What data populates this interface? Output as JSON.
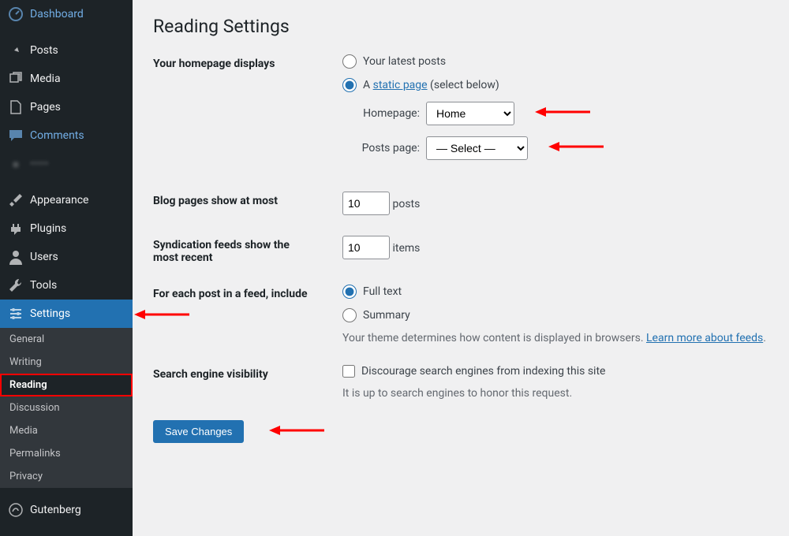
{
  "sidebar": {
    "items": [
      "Dashboard",
      "Posts",
      "Media",
      "Pages",
      "Comments"
    ],
    "items2": [
      "Appearance",
      "Plugins",
      "Users",
      "Tools",
      "Settings"
    ],
    "settings_sub": [
      "General",
      "Writing",
      "Reading",
      "Discussion",
      "Media",
      "Permalinks",
      "Privacy"
    ],
    "items3": [
      "Gutenberg"
    ]
  },
  "icons": {
    "dashboard": "dashboard-icon",
    "posts": "pin-icon",
    "media": "media-icon",
    "pages": "pages-icon",
    "comments": "comments-icon",
    "appearance": "brush-icon",
    "plugins": "plug-icon",
    "users": "user-icon",
    "tools": "wrench-icon",
    "settings": "sliders-icon",
    "gutenberg": "gutenberg-icon"
  },
  "page": {
    "title": "Reading Settings",
    "rows": {
      "homepage_label": "Your homepage displays",
      "radio_latest": "Your latest posts",
      "radio_static_prefix": "A ",
      "radio_static_link": "static page",
      "radio_static_suffix": " (select below)",
      "homepage_select_label": "Homepage:",
      "homepage_select_value": "Home",
      "posts_page_label": "Posts page:",
      "posts_page_value": "— Select —",
      "blog_pages_label": "Blog pages show at most",
      "blog_pages_value": "10",
      "blog_pages_unit": "posts",
      "syndication_label": "Syndication feeds show the most recent",
      "syndication_value": "10",
      "syndication_unit": "items",
      "feed_include_label": "For each post in a feed, include",
      "feed_full": "Full text",
      "feed_summary": "Summary",
      "feed_note_pre": "Your theme determines how content is displayed in browsers. ",
      "feed_note_link": "Learn more about feeds",
      "search_label": "Search engine visibility",
      "search_checkbox": "Discourage search engines from indexing this site",
      "search_note": "It is up to search engines to honor this request.",
      "save": "Save Changes"
    }
  }
}
